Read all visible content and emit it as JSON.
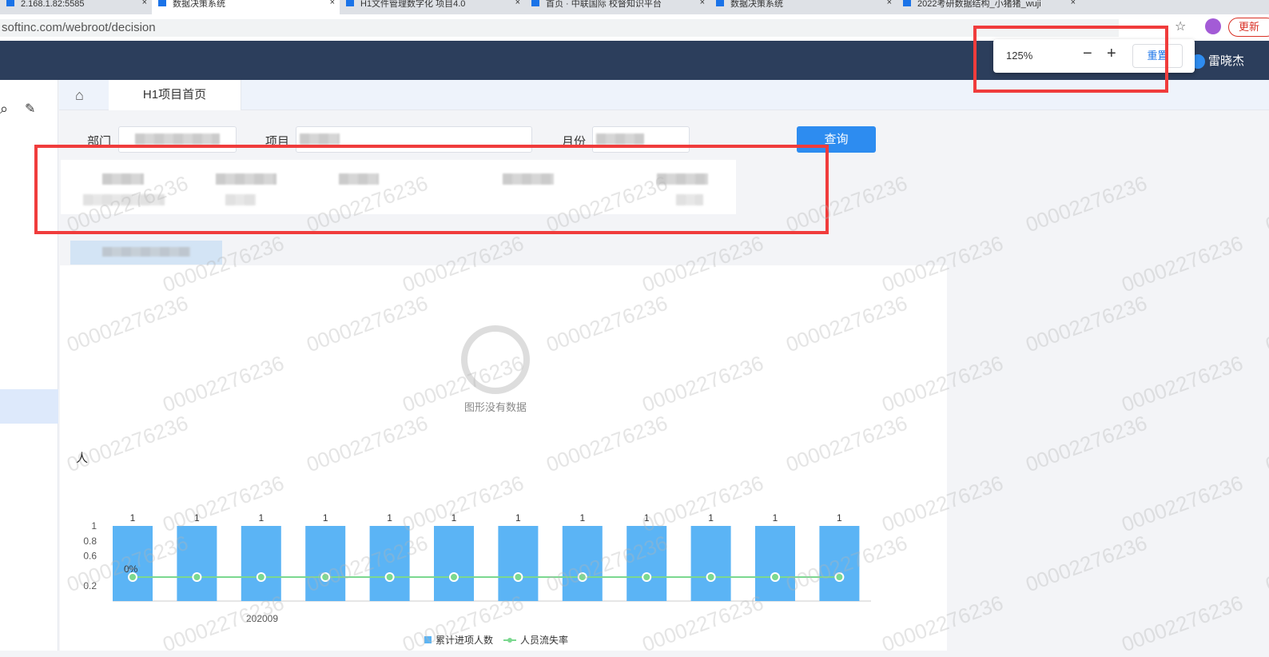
{
  "browser": {
    "tabs": [
      {
        "label": "2.168.1.82:5585",
        "active": false
      },
      {
        "label": "数据决策系统",
        "active": true
      },
      {
        "label": "H1文件管理数字化 项目4.0",
        "active": false
      },
      {
        "label": "首页 · 中联国际 校督知识平台",
        "active": false
      },
      {
        "label": "数据决策系统",
        "active": false
      },
      {
        "label": "2022考研数据结构_小猪猪_wuji",
        "active": false
      }
    ],
    "url": "softinc.com/webroot/decision",
    "update_label": "更新",
    "zoom_popup": {
      "zoom": "125%",
      "minus": "−",
      "plus": "+",
      "reset": "重置"
    }
  },
  "header": {
    "user": "雷晓杰"
  },
  "tabbar": {
    "page_tab": "H1项目首页"
  },
  "filters": {
    "dept_label": "部门",
    "project_label": "项目",
    "month_label": "月份",
    "query_button": "查询"
  },
  "empty_chart": {
    "message": "图形没有数据"
  },
  "watermark": "00002276236",
  "chart_data": {
    "type": "bar",
    "title": "",
    "categories": [
      "",
      "",
      "",
      "",
      "",
      "",
      "",
      "",
      "",
      "",
      "",
      ""
    ],
    "x_visible_label": "202009",
    "ylim": [
      0,
      1
    ],
    "yticks": [
      "1",
      "0.8",
      "0.6",
      "0.2"
    ],
    "series": [
      {
        "name": "累计进项人数",
        "type": "bar",
        "color": "#5bb4f5",
        "values": [
          1,
          1,
          1,
          1,
          1,
          1,
          1,
          1,
          1,
          1,
          1,
          1
        ]
      },
      {
        "name": "人员流失率",
        "type": "line",
        "color": "#7bd88f",
        "values": [
          0,
          0,
          0,
          0,
          0,
          0,
          0,
          0,
          0,
          0,
          0,
          0
        ],
        "first_label": "0%"
      }
    ],
    "legend": "bottom-center"
  }
}
